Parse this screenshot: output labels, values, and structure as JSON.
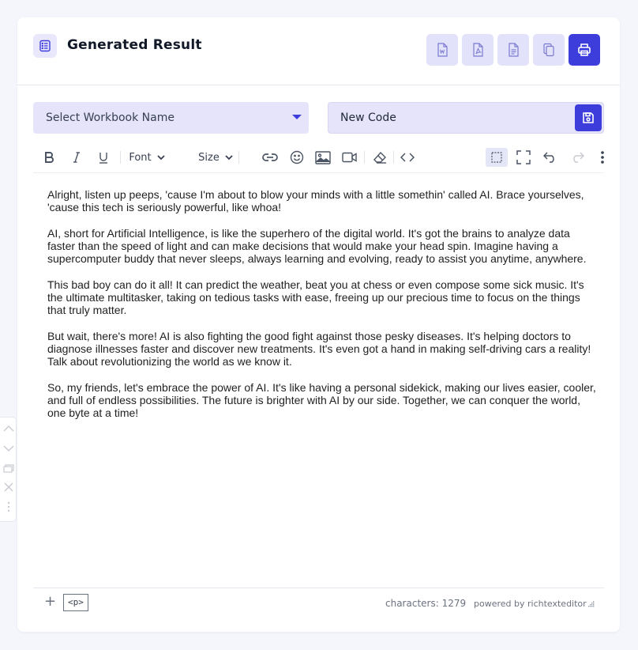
{
  "header": {
    "title": "Generated Result",
    "buttons": [
      {
        "name": "word",
        "icon": "word-doc-icon"
      },
      {
        "name": "pdf",
        "icon": "pdf-doc-icon"
      },
      {
        "name": "text",
        "icon": "text-doc-icon"
      },
      {
        "name": "copy",
        "icon": "copy-icon"
      },
      {
        "name": "print",
        "icon": "printer-icon"
      }
    ]
  },
  "form": {
    "workbook_select": "Select Workbook Name",
    "code_name_value": "New Code"
  },
  "toolbar": {
    "font_label": "Font",
    "size_label": "Size"
  },
  "content": {
    "paragraphs": [
      "Alright, listen up peeps, 'cause I'm about to blow your minds with a little somethin' called AI. Brace yourselves, 'cause this tech is seriously powerful, like whoa!",
      "AI, short for Artificial Intelligence, is like the superhero of the digital world. It's got the brains to analyze data faster than the speed of light and can make decisions that would make your head spin. Imagine having a supercomputer buddy that never sleeps, always learning and evolving, ready to assist you anytime, anywhere.",
      "This bad boy can do it all! It can predict the weather, beat you at chess or even compose some sick music. It's the ultimate multitasker, taking on tedious tasks with ease, freeing up our precious time to focus on the things that truly matter.",
      "But wait, there's more! AI is also fighting the good fight against those pesky diseases. It's helping doctors to diagnose illnesses faster and discover new treatments. It's even got a hand in making self-driving cars a reality! Talk about revolutionizing the world as we know it.",
      "So, my friends, let's embrace the power of AI. It's like having a personal sidekick, making our lives easier, cooler, and full of endless possibilities. The future is brighter with AI by our side. Together, we can conquer the world, one byte at a time!"
    ]
  },
  "footer": {
    "tag": "<p>",
    "characters": "characters: 1279",
    "powered_by": "powered by richtexteditor"
  },
  "colors": {
    "accent": "#3d3ddc",
    "accent_light": "#e3e2fb",
    "page_bg": "#f4f6fc"
  }
}
